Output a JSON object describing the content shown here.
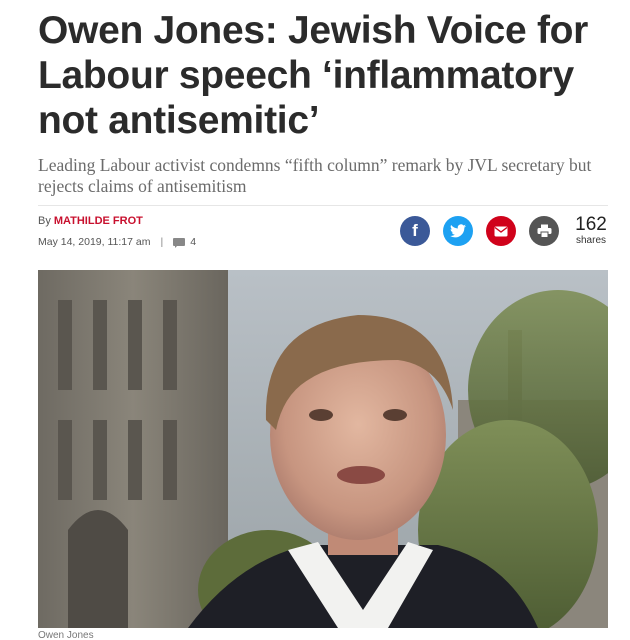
{
  "article": {
    "headline": "Owen Jones: Jewish Voice for Labour speech ‘inflammatory not antisemitic’",
    "subhead": "Leading Labour activist condemns “fifth column” remark by JVL secretary but rejects claims of antisemitism",
    "byline_prefix": "By",
    "author": "MATHILDE FROT",
    "date": "May 14, 2019, 11:17 am",
    "separator": "|",
    "comment_count": "4",
    "image_caption": "Owen Jones"
  },
  "share": {
    "facebook_glyph": "f",
    "count": "162",
    "count_label": "shares",
    "icons": [
      "facebook-icon",
      "twitter-icon",
      "email-icon",
      "print-icon"
    ],
    "colors": {
      "facebook": "#3b5998",
      "twitter": "#1da1f2",
      "email": "#d0021b",
      "print": "#555555"
    }
  },
  "theme": {
    "author_color": "#c8102e",
    "headline_color": "#2b2b2b",
    "subhead_color": "#6b6b6b"
  }
}
